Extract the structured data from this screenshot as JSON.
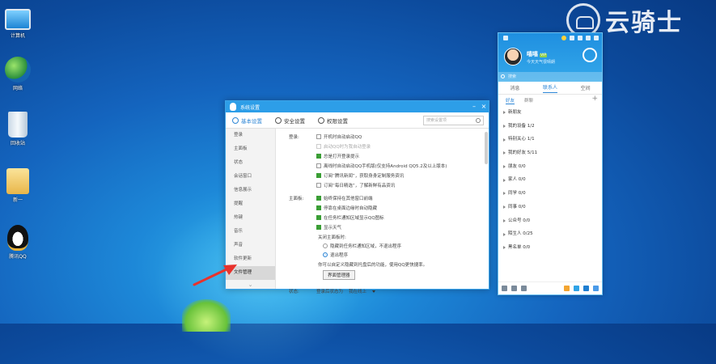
{
  "watermark": {
    "text": "云骑士"
  },
  "desktop": {
    "icons": [
      {
        "name": "computer",
        "label": "计算机"
      },
      {
        "name": "network",
        "label": "网络"
      },
      {
        "name": "recycle-bin",
        "label": "回收站"
      },
      {
        "name": "folder",
        "label": "新一"
      },
      {
        "name": "qq",
        "label": "腾讯QQ"
      }
    ]
  },
  "settings_window": {
    "title": "系统设置",
    "tabs": [
      {
        "label": "基本设置",
        "active": true
      },
      {
        "label": "安全设置",
        "active": false
      },
      {
        "label": "权限设置",
        "active": false
      }
    ],
    "search_placeholder": "搜索设置项",
    "nav": [
      "登录",
      "主面板",
      "状态",
      "会话窗口",
      "信息展示",
      "提醒",
      "热键",
      "音乐",
      "声音",
      "软件更新",
      "文件管理"
    ],
    "nav_active_index": 10,
    "login_section": {
      "label": "登录:",
      "options": [
        {
          "text": "开机时自动启动QQ",
          "checked": false,
          "disabled": false
        },
        {
          "text": "启动QQ时为我自动登录",
          "checked": false,
          "disabled": true
        },
        {
          "text": "总是打开登录提示",
          "checked": true,
          "disabled": false
        },
        {
          "text": "离线时自动启动QQ手机版(仅支持Android QQ5.2及以上版本)",
          "checked": false,
          "disabled": false
        },
        {
          "text": "订阅“腾讯新闻”，获取身身定制服务资讯",
          "checked": true,
          "disabled": false
        },
        {
          "text": "订阅“每日精选”，了解新鲜有品资讯",
          "checked": false,
          "disabled": false
        }
      ]
    },
    "main_section": {
      "label": "主面板:",
      "options": [
        {
          "text": "始终保持在其他窗口前端",
          "checked": true
        },
        {
          "text": "停靠在桌面边缘时自动隐藏",
          "checked": true
        },
        {
          "text": "在任务栏通知区域显示QQ图标",
          "checked": true
        },
        {
          "text": "显示天气",
          "checked": true
        }
      ],
      "close_label": "关闭主面板时:",
      "close_options": [
        {
          "text": "隐藏到任务栏通知区域，不退出程序",
          "selected": false
        },
        {
          "text": "退出程序",
          "selected": true
        }
      ],
      "note": "你可以自定义隐藏到托盘后的功能，使用QQ更快捷率。",
      "button": "界面管理器"
    },
    "status_section": {
      "label": "状态:",
      "login_state_label": "登录后状态为",
      "login_state_value": "我在线上"
    }
  },
  "qq_panel": {
    "nickname": "嘻嘻",
    "vip": "VIP",
    "signature": "今天天气很晴朗",
    "search_placeholder": "搜索",
    "tabs": [
      {
        "label": "消息",
        "active": false
      },
      {
        "label": "联系人",
        "active": true
      },
      {
        "label": "空间",
        "active": false
      }
    ],
    "subtabs": [
      {
        "label": "好友",
        "active": true
      },
      {
        "label": "群聊",
        "active": false
      }
    ],
    "groups": [
      "新朋友",
      "我的设备 1/2",
      "特别关心 1/1",
      "我的好友 5/11",
      "朋友 0/0",
      "家人 0/0",
      "同学 0/0",
      "同事 0/0",
      "公众号 0/0",
      "陌生人 0/25",
      "黑名单 0/0"
    ]
  }
}
